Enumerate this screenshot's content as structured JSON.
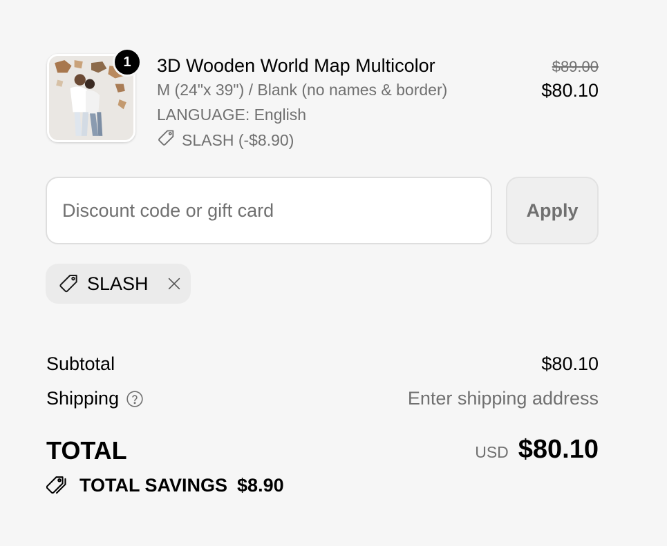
{
  "product": {
    "quantity_badge": "1",
    "title": "3D Wooden World Map Multicolor",
    "variant": "M (24\"x 39\") / Blank (no names & border)",
    "language": "LANGUAGE: English",
    "discount_line": "SLASH (-$8.90)",
    "price_original": "$89.00",
    "price_discounted": "$80.10",
    "image_icon": "product-photo"
  },
  "discount_form": {
    "placeholder": "Discount code or gift card",
    "value": "",
    "apply_label": "Apply"
  },
  "applied_code": {
    "label": "SLASH",
    "icon": "tag-icon",
    "remove_icon": "close-icon"
  },
  "summary": {
    "subtotal_label": "Subtotal",
    "subtotal_value": "$80.10",
    "shipping_label": "Shipping",
    "shipping_help_icon": "question-circle-icon",
    "shipping_value": "Enter shipping address",
    "total_label": "TOTAL",
    "currency": "USD",
    "total_value": "$80.10",
    "savings_icon": "tags-icon",
    "savings_label": "TOTAL SAVINGS",
    "savings_value": "$8.90"
  },
  "colors": {
    "background": "#f6f6f6",
    "muted_text": "#707070",
    "badge": "#000000"
  }
}
